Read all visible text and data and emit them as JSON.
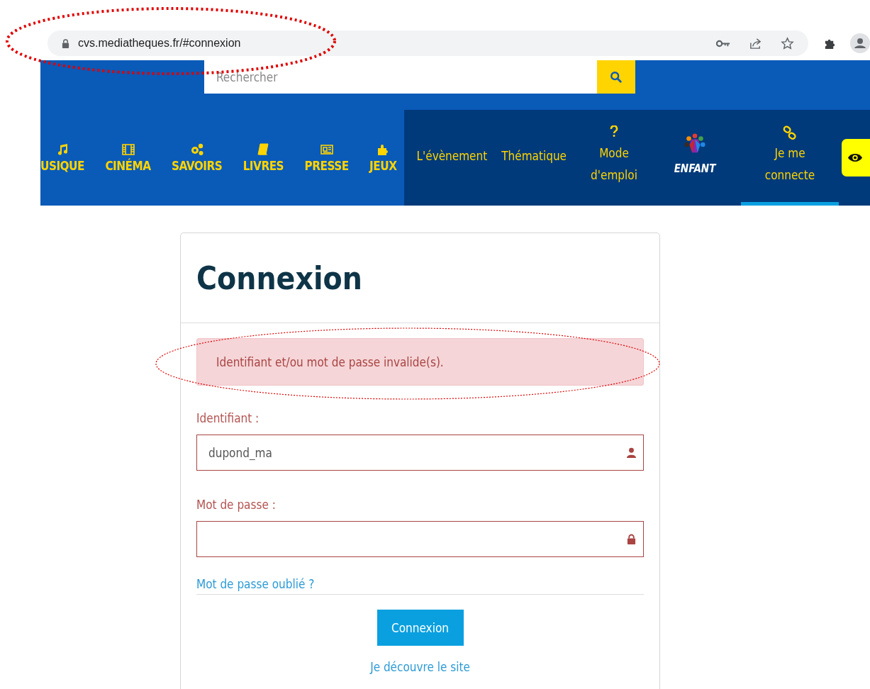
{
  "browser": {
    "url": "cvs.mediatheques.fr/#connexion"
  },
  "search": {
    "placeholder": "Rechercher"
  },
  "categories": [
    {
      "label": "USIQUE"
    },
    {
      "label": "CINÉMA"
    },
    {
      "label": "SAVOIRS"
    },
    {
      "label": "LIVRES"
    },
    {
      "label": "PRESSE"
    },
    {
      "label": "JEUX"
    }
  ],
  "nav_links": [
    {
      "kind": "text",
      "label": "L'évènement",
      "selected": false
    },
    {
      "kind": "text",
      "label": "Thématique",
      "selected": false
    },
    {
      "kind": "help",
      "label": "Mode d'emploi",
      "selected": false
    },
    {
      "kind": "logo",
      "label": "ENFANT",
      "selected": false
    },
    {
      "kind": "login",
      "label": "Je me connecte",
      "selected": true
    }
  ],
  "login": {
    "title": "Connexion",
    "alert": "Identifiant et/ou mot de passe invalide(s).",
    "fields": [
      {
        "kind": "user",
        "label": "Identifiant :",
        "value": "dupond_ma",
        "invalid": true
      },
      {
        "kind": "password",
        "label": "Mot de passe :",
        "invalid": true
      }
    ],
    "forgot_link": "Mot de passe oublié ?",
    "submit": "Connexion",
    "discover_link": "Je découvre le site"
  }
}
